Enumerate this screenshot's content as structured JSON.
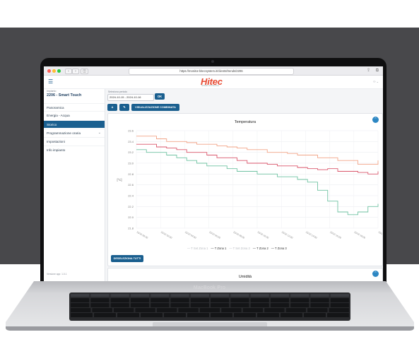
{
  "browser": {
    "url": "https://monitor.hitecsystem.it/clients/trends/2206",
    "nav_back": "‹",
    "nav_forward": "›",
    "sidebar_toggle": "◫",
    "share_icon": "share-icon",
    "tabs_icon": "tabs-icon"
  },
  "header": {
    "logo": "Hitec",
    "logo_sub": "Software and Services"
  },
  "sidebar": {
    "impianto_label": "Impianto",
    "impianto_title": "2206 - Smart Touch",
    "items": [
      {
        "label": "Panoramica",
        "active": false
      },
      {
        "label": "Energia - Acqua",
        "active": false
      },
      {
        "label": "Storico",
        "active": true
      },
      {
        "label": "Programmazione oraria",
        "active": false,
        "caret": "⌄"
      },
      {
        "label": "Impostazioni",
        "active": false
      },
      {
        "label": "Info impianto",
        "active": false
      }
    ],
    "footer": "Versione app: 1.0.1"
  },
  "toolbar": {
    "period_label": "Seleziona periodo",
    "period_value": "2024-10-15 - 2024-10-16",
    "ok_label": "OK",
    "btn_a": "A",
    "btn_edit": "✎",
    "btn_combined": "VISUALIZZAZIONE COMBINATA"
  },
  "chart_card": {
    "deselect_label": "DESELEZIONA TUTTI",
    "toggle_icon": "chevron-up-icon"
  },
  "chart_data": {
    "type": "line",
    "title": "Temperatura",
    "ylabel": "[°C]",
    "ylim": [
      21.8,
      23.6
    ],
    "yticks": [
      21.8,
      22,
      22.2,
      22.4,
      22.6,
      22.8,
      23,
      23.2,
      23.4,
      23.6
    ],
    "x": [
      0,
      1,
      2,
      3,
      4,
      5,
      6,
      7,
      8,
      9,
      10,
      11,
      12,
      13,
      14,
      15,
      16,
      17,
      18,
      19,
      20,
      21,
      22,
      23,
      24
    ],
    "xtick_labels": [
      "15/10 00:00",
      "15/10 02:00",
      "15/10 04:00",
      "15/10 06:00",
      "15/10 08:00",
      "15/10 10:00",
      "15/10 12:00",
      "15/10 14:00",
      "15/10 16:00",
      "15/10 18:00",
      "15/10 20:00"
    ],
    "series": [
      {
        "name": "T Set Zona 1",
        "visible": false,
        "color": "#c9ccd1",
        "values": []
      },
      {
        "name": "T Zona 1",
        "visible": true,
        "color": "#f2a487",
        "values": [
          23.5,
          23.5,
          23.45,
          23.4,
          23.4,
          23.38,
          23.35,
          23.35,
          23.32,
          23.3,
          23.28,
          23.25,
          23.25,
          23.2,
          23.2,
          23.18,
          23.15,
          23.15,
          23.1,
          23.1,
          23.05,
          23.05,
          22.98,
          22.98,
          23.05
        ]
      },
      {
        "name": "T Set Zona 2",
        "visible": false,
        "color": "#c9ccd1",
        "values": []
      },
      {
        "name": "T Zona 2",
        "visible": true,
        "color": "#d9566b",
        "values": [
          23.35,
          23.35,
          23.3,
          23.28,
          23.25,
          23.2,
          23.2,
          23.15,
          23.1,
          23.1,
          23.05,
          23.0,
          23.0,
          22.98,
          22.95,
          22.95,
          22.92,
          22.9,
          22.88,
          22.9,
          22.85,
          22.85,
          22.83,
          22.8,
          22.85
        ]
      },
      {
        "name": "T Zona 3",
        "visible": true,
        "color": "#6fc2a2",
        "values": [
          23.25,
          23.2,
          23.2,
          23.15,
          23.1,
          23.05,
          23.0,
          22.95,
          22.95,
          22.9,
          22.85,
          22.85,
          22.8,
          22.8,
          22.75,
          22.75,
          22.7,
          22.65,
          22.5,
          22.3,
          22.1,
          22.05,
          22.1,
          22.2,
          22.25
        ]
      }
    ],
    "grid": true,
    "legend_position": "bottom-center"
  },
  "second_card": {
    "title": "Umidità",
    "toggle_icon": "chevron-up-icon"
  },
  "laptop": {
    "label": "MacBook Pro"
  }
}
